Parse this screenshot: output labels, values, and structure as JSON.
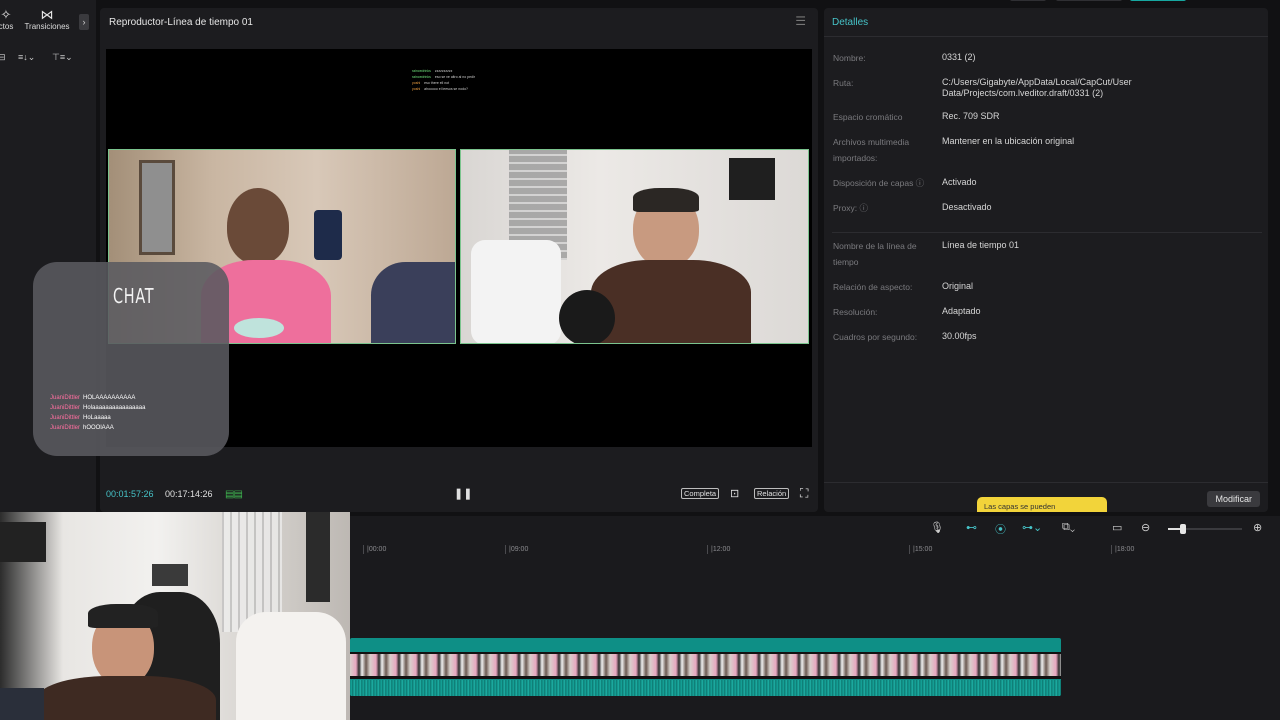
{
  "left_panel": {
    "tab_efectos": "ctos",
    "tab_transiciones": "Transiciones",
    "sort_icon_1": "≡↓⌄",
    "sort_icon_2": "⊤≡⌄"
  },
  "player": {
    "title": "Reproductor-Línea de tiempo 01",
    "stream_chat": [
      {
        "user": "raincedrinks",
        "text": "zzzzzzzzzz"
      },
      {
        "user": "raincedrinks",
        "text": "eso se ve altro al no pedir"
      },
      {
        "user": "yoshi",
        "text": "eso there ell not"
      },
      {
        "user": "yoshi",
        "text": "ahooooo el leesos se nodo?"
      }
    ],
    "time_current": "00:01:57:26",
    "time_total": "00:17:14:26",
    "btn_full": "Completa",
    "btn_ratio": "Relación"
  },
  "chat_overlay": {
    "title": "CHAT",
    "messages": [
      {
        "user": "JuaniDittler",
        "text": "HOLAAAAAAAAAA"
      },
      {
        "user": "JuaniDittler",
        "text": "Holaaaaaaaaaaaaaaaa"
      },
      {
        "user": "JuaniDittler",
        "text": "HoLaaaaa"
      },
      {
        "user": "JuaniDittler",
        "text": "hOOOlAAA"
      }
    ]
  },
  "details": {
    "title": "Detalles",
    "rows": [
      {
        "label": "Nombre:",
        "value": "0331 (2)"
      },
      {
        "label": "Ruta:",
        "value": "C:/Users/Gigabyte/AppData/Local/CapCut/User Data/Projects/com.lveditor.draft/0331 (2)"
      },
      {
        "label": "Espacio cromático",
        "value": "Rec. 709 SDR"
      },
      {
        "label": "Archivos multimedia importados:",
        "value": "Mantener en la ubicación original"
      },
      {
        "label": "Disposición de capas ⓘ",
        "value": "Activado"
      },
      {
        "label": "Proxy: ⓘ",
        "value": "Desactivado"
      },
      {
        "label": "Nombre de la línea de tiempo",
        "value": "Línea de tiempo 01"
      },
      {
        "label": "Relación de aspecto:",
        "value": "Original"
      },
      {
        "label": "Resolución:",
        "value": "Adaptado"
      },
      {
        "label": "Cuadros por segundo:",
        "value": "30.00fps"
      }
    ],
    "modify_btn": "Modificar",
    "tooltip": "Las capas se pueden"
  },
  "timeline": {
    "ruler": [
      "|00:00",
      "|09:00",
      "|12:00",
      "|15:00",
      "|18:00"
    ],
    "zoom_level": 0.2
  },
  "colors": {
    "accent": "#46c3c8",
    "clip": "#0e8f86",
    "tooltip": "#f2d43a",
    "chat_user": "#ff6fa0"
  }
}
